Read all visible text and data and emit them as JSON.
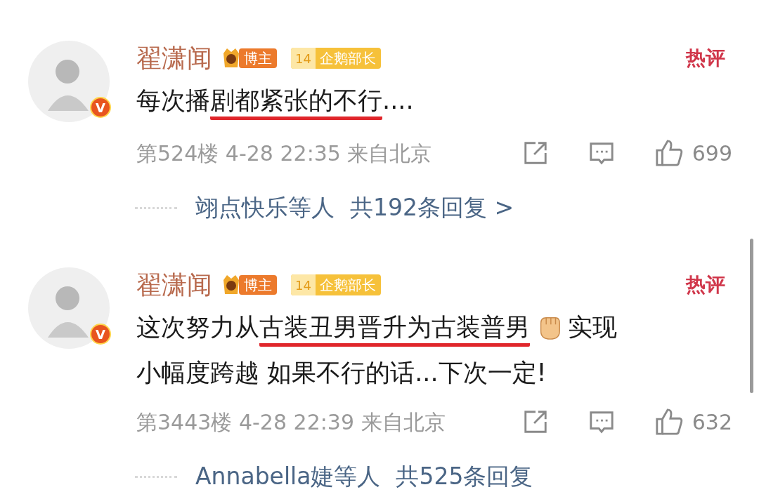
{
  "comments": [
    {
      "author": "翟潇闻",
      "verified_mark": "V",
      "badges": [
        {
          "kind": "blogger",
          "label": "博主"
        },
        {
          "kind": "level",
          "level_number": "14",
          "label": "企鹅部长"
        }
      ],
      "hot_label": "热评",
      "content_lines": [
        [
          {
            "kind": "text",
            "text": "每次播"
          },
          {
            "kind": "underlined",
            "text": "剧都紧张的不行"
          },
          {
            "kind": "text",
            "text": "...."
          }
        ]
      ],
      "floor": "第524楼",
      "date": "4-28",
      "time": "22:35",
      "location": "来自北京",
      "likes": "699",
      "replies_by": "翊点快乐等人",
      "replies_count": "共192条回复",
      "replies_arrow": ">"
    },
    {
      "author": "翟潇闻",
      "verified_mark": "V",
      "badges": [
        {
          "kind": "blogger",
          "label": "博主"
        },
        {
          "kind": "level",
          "level_number": "14",
          "label": "企鹅部长"
        }
      ],
      "hot_label": "热评",
      "content_lines": [
        [
          {
            "kind": "text",
            "text": "这次努力从"
          },
          {
            "kind": "underlined",
            "text": "古装丑男晋升为古装普男"
          },
          {
            "kind": "fist_emoji"
          },
          {
            "kind": "text",
            "text": "实现"
          }
        ],
        [
          {
            "kind": "text",
            "text": "小幅度跨越 如果不行的话...下次一定!"
          }
        ]
      ],
      "floor": "第3443楼",
      "date": "4-28",
      "time": "22:39",
      "location": "来自北京",
      "likes": "632",
      "replies_by": "Annabella婕等人",
      "replies_count": "共525条回复"
    }
  ]
}
